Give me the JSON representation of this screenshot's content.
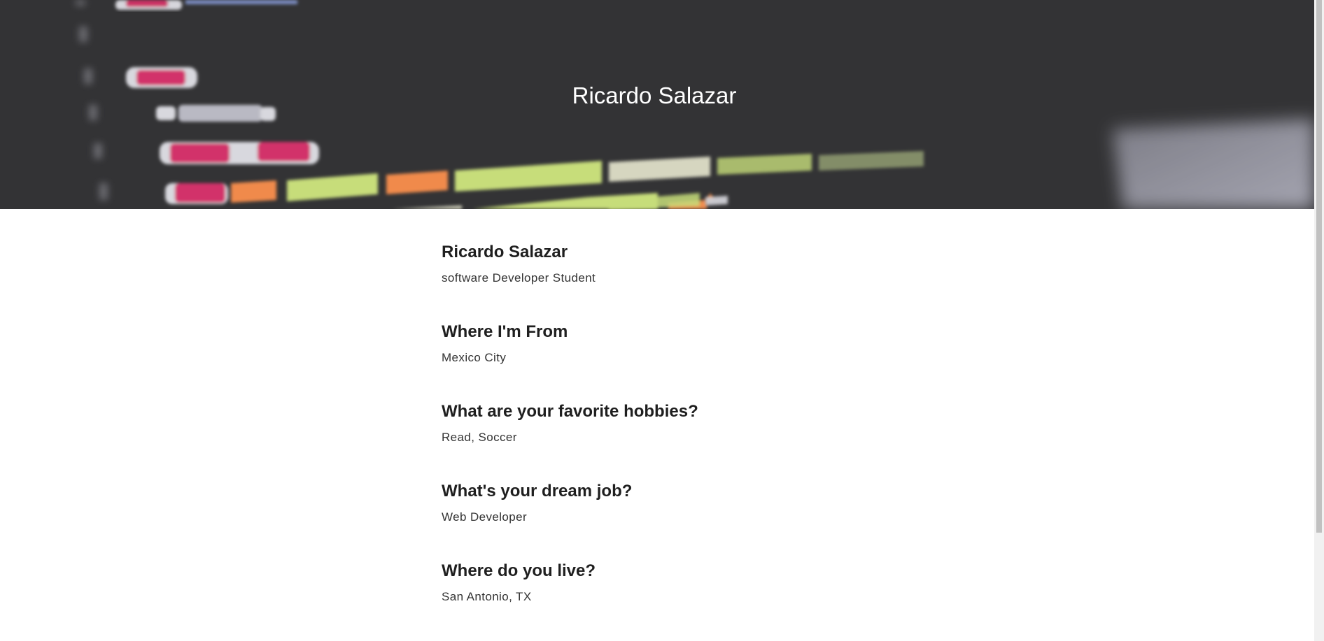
{
  "header": {
    "title": "Ricardo Salazar"
  },
  "profile": {
    "sections": [
      {
        "heading": "Ricardo Salazar",
        "answer": "software Developer Student"
      },
      {
        "heading": "Where I'm From",
        "answer": "Mexico City"
      },
      {
        "heading": "What are your favorite hobbies?",
        "answer": "Read, Soccer"
      },
      {
        "heading": "What's your dream job?",
        "answer": "Web Developer"
      },
      {
        "heading": "Where do you live?",
        "answer": "San Antonio, TX"
      }
    ]
  },
  "colors": {
    "hero_background": "#333335",
    "heading_text": "#1f1f1f",
    "body_text": "#333333",
    "page_background": "#ffffff"
  }
}
